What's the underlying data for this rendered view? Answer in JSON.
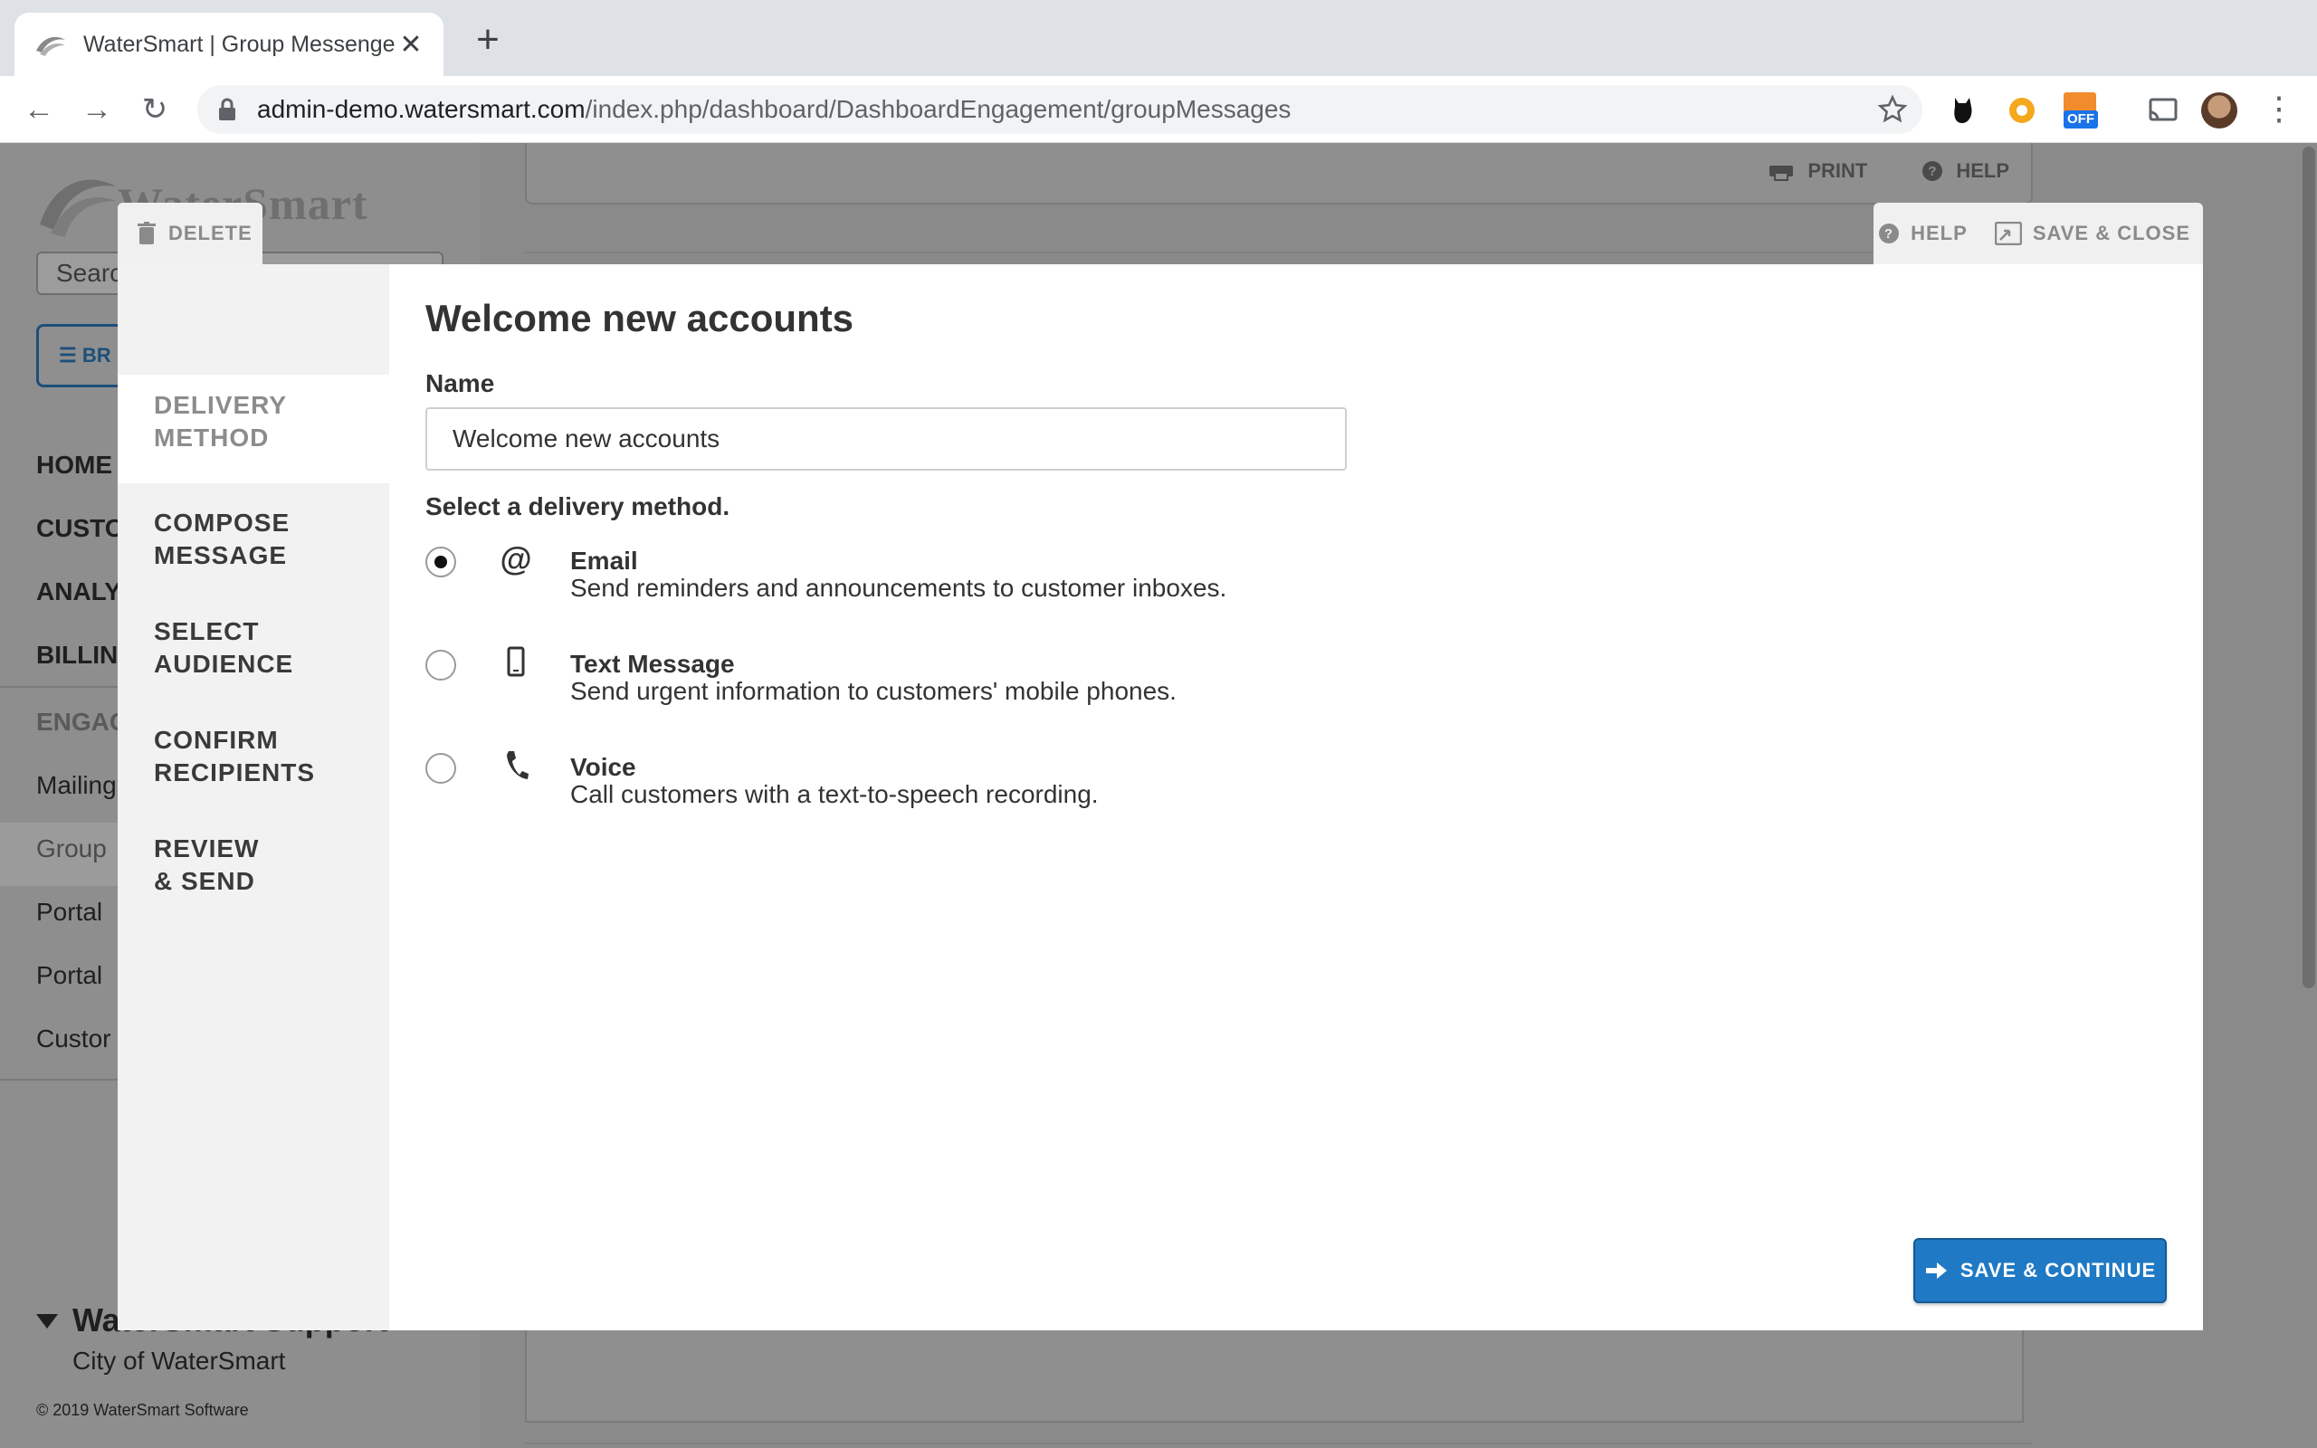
{
  "browser": {
    "tab_title": "WaterSmart | Group Messenger",
    "url_domain": "admin-demo.watersmart.com",
    "url_path": "/index.php/dashboard/DashboardEngagement/groupMessages",
    "ext_badge": "OFF"
  },
  "background": {
    "logo_text": "WaterSmart",
    "search_placeholder": "Search",
    "browse_label": "BR",
    "nav": [
      "HOME",
      "CUSTO",
      "ANALY",
      "BILLIN"
    ],
    "engagement_label": "ENGAG",
    "engagement_items": [
      "Mailing",
      "Group",
      "Portal",
      "Portal",
      "Custor"
    ],
    "user_name": "WaterSmart Support",
    "user_org": "City of WaterSmart",
    "copyright": "© 2019 WaterSmart Software",
    "panel_print": "PRINT",
    "panel_help": "HELP"
  },
  "modal": {
    "delete_label": "DELETE",
    "help_label": "HELP",
    "save_close_label": "SAVE & CLOSE",
    "steps": [
      {
        "line1": "DELIVERY",
        "line2": "METHOD"
      },
      {
        "line1": "COMPOSE",
        "line2": "MESSAGE"
      },
      {
        "line1": "SELECT",
        "line2": "AUDIENCE"
      },
      {
        "line1": "CONFIRM",
        "line2": "RECIPIENTS"
      },
      {
        "line1": "REVIEW",
        "line2": "& SEND"
      }
    ],
    "title": "Welcome new accounts",
    "name_label": "Name",
    "name_value": "Welcome new accounts",
    "delivery_label": "Select a delivery method.",
    "options": [
      {
        "title": "Email",
        "desc": "Send reminders and announcements to customer inboxes.",
        "icon": "at-icon",
        "selected": true
      },
      {
        "title": "Text Message",
        "desc": "Send urgent information to customers' mobile phones.",
        "icon": "mobile-phone-icon",
        "selected": false
      },
      {
        "title": "Voice",
        "desc": "Call customers with a text-to-speech recording.",
        "icon": "phone-handset-icon",
        "selected": false
      }
    ],
    "save_continue_label": "SAVE & CONTINUE"
  },
  "colors": {
    "primary": "#1f79c4",
    "overlay": "#8a8a8a"
  }
}
